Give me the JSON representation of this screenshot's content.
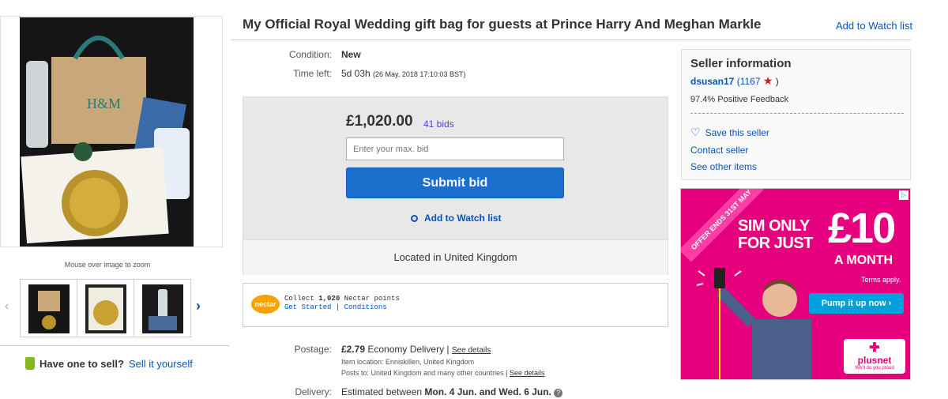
{
  "listing": {
    "title": "My Official Royal Wedding gift bag for guests at Prince Harry And Meghan Markle",
    "watch_link": "Add to Watch list"
  },
  "gallery": {
    "zoom_hint": "Mouse over image to zoom",
    "prev_icon": "chevron-left-icon",
    "next_icon": "chevron-right-icon"
  },
  "details": {
    "condition_label": "Condition:",
    "condition_value": "New",
    "time_label": "Time left:",
    "time_value": "5d 03h",
    "time_end": "(26 May, 2018  17:10:03 BST)"
  },
  "bid": {
    "price": "£1,020.00",
    "bids": "41 bids",
    "placeholder": "Enter your max. bid",
    "submit": "Submit bid",
    "watch": "Add to Watch list",
    "location": "Located in United Kingdom"
  },
  "nectar": {
    "logo": "nectar",
    "collect_prefix": "Collect",
    "points": "1,020",
    "collect_suffix": "Nectar points",
    "get_started": "Get Started",
    "separator": "|",
    "conditions": "Conditions"
  },
  "shipping": {
    "postage_label": "Postage:",
    "postage_price": "£2.79",
    "postage_service": "Economy Delivery |",
    "see_details": "See details",
    "item_location": "Item location:  Enniskillen, United Kingdom",
    "posts_to": "Posts to:  United Kingdom and many other countries |",
    "posts_details": "See details",
    "delivery_label": "Delivery:",
    "delivery_prefix": "Estimated between",
    "delivery_dates": "Mon. 4 Jun. and Wed. 6 Jun.",
    "info_icon": "?"
  },
  "seller": {
    "heading": "Seller information",
    "username": "dsusan17",
    "score_open": "(1167",
    "score_close": ")",
    "feedback": "97.4% Positive Feedback",
    "save": "Save this seller",
    "contact": "Contact seller",
    "other_items": "See other items"
  },
  "sell": {
    "question": "Have one to sell?",
    "link": "Sell it yourself"
  },
  "ad": {
    "offer": "OFFER ENDS 31ST MAY",
    "line1": "SIM ONLY",
    "line2": "FOR JUST",
    "price": "£10",
    "period": "A MONTH",
    "terms": "Terms apply.",
    "cta": "Pump it up now",
    "brand": "plusnet",
    "tagline": "We'll do you proud",
    "brand_color": "#e6007e"
  },
  "colors": {
    "link": "#0654ba",
    "button": "#1b6fcd",
    "bids": "#5f3dc4"
  }
}
